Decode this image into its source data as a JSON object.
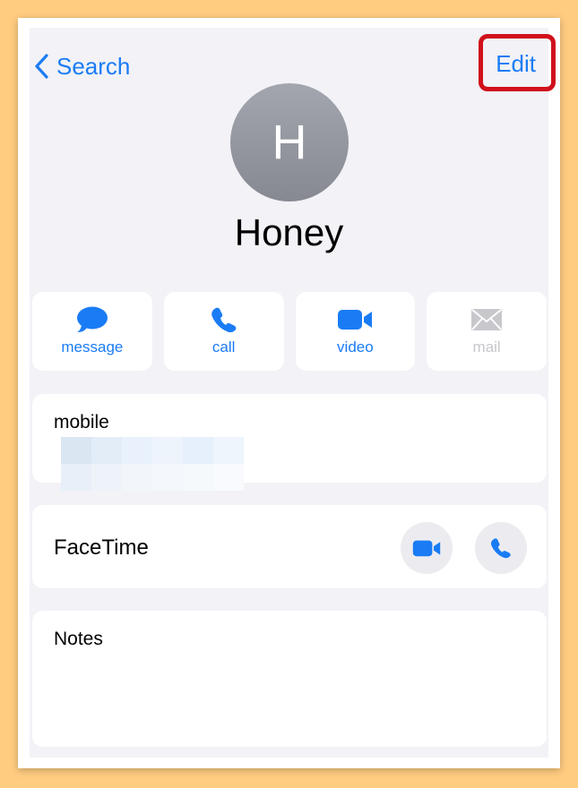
{
  "nav": {
    "back_label": "Search",
    "edit_label": "Edit"
  },
  "contact": {
    "initial": "H",
    "name": "Honey"
  },
  "actions": [
    {
      "label": "message",
      "icon": "message-bubble-icon",
      "enabled": true
    },
    {
      "label": "call",
      "icon": "phone-icon",
      "enabled": true
    },
    {
      "label": "video",
      "icon": "video-camera-icon",
      "enabled": true
    },
    {
      "label": "mail",
      "icon": "envelope-icon",
      "enabled": false
    }
  ],
  "mobile": {
    "label": "mobile"
  },
  "facetime": {
    "label": "FaceTime"
  },
  "notes": {
    "label": "Notes"
  },
  "colors": {
    "accent": "#1a7cf5",
    "highlight": "#d0101c",
    "background": "#f2f2f7",
    "disabled": "#c7c7cc"
  }
}
